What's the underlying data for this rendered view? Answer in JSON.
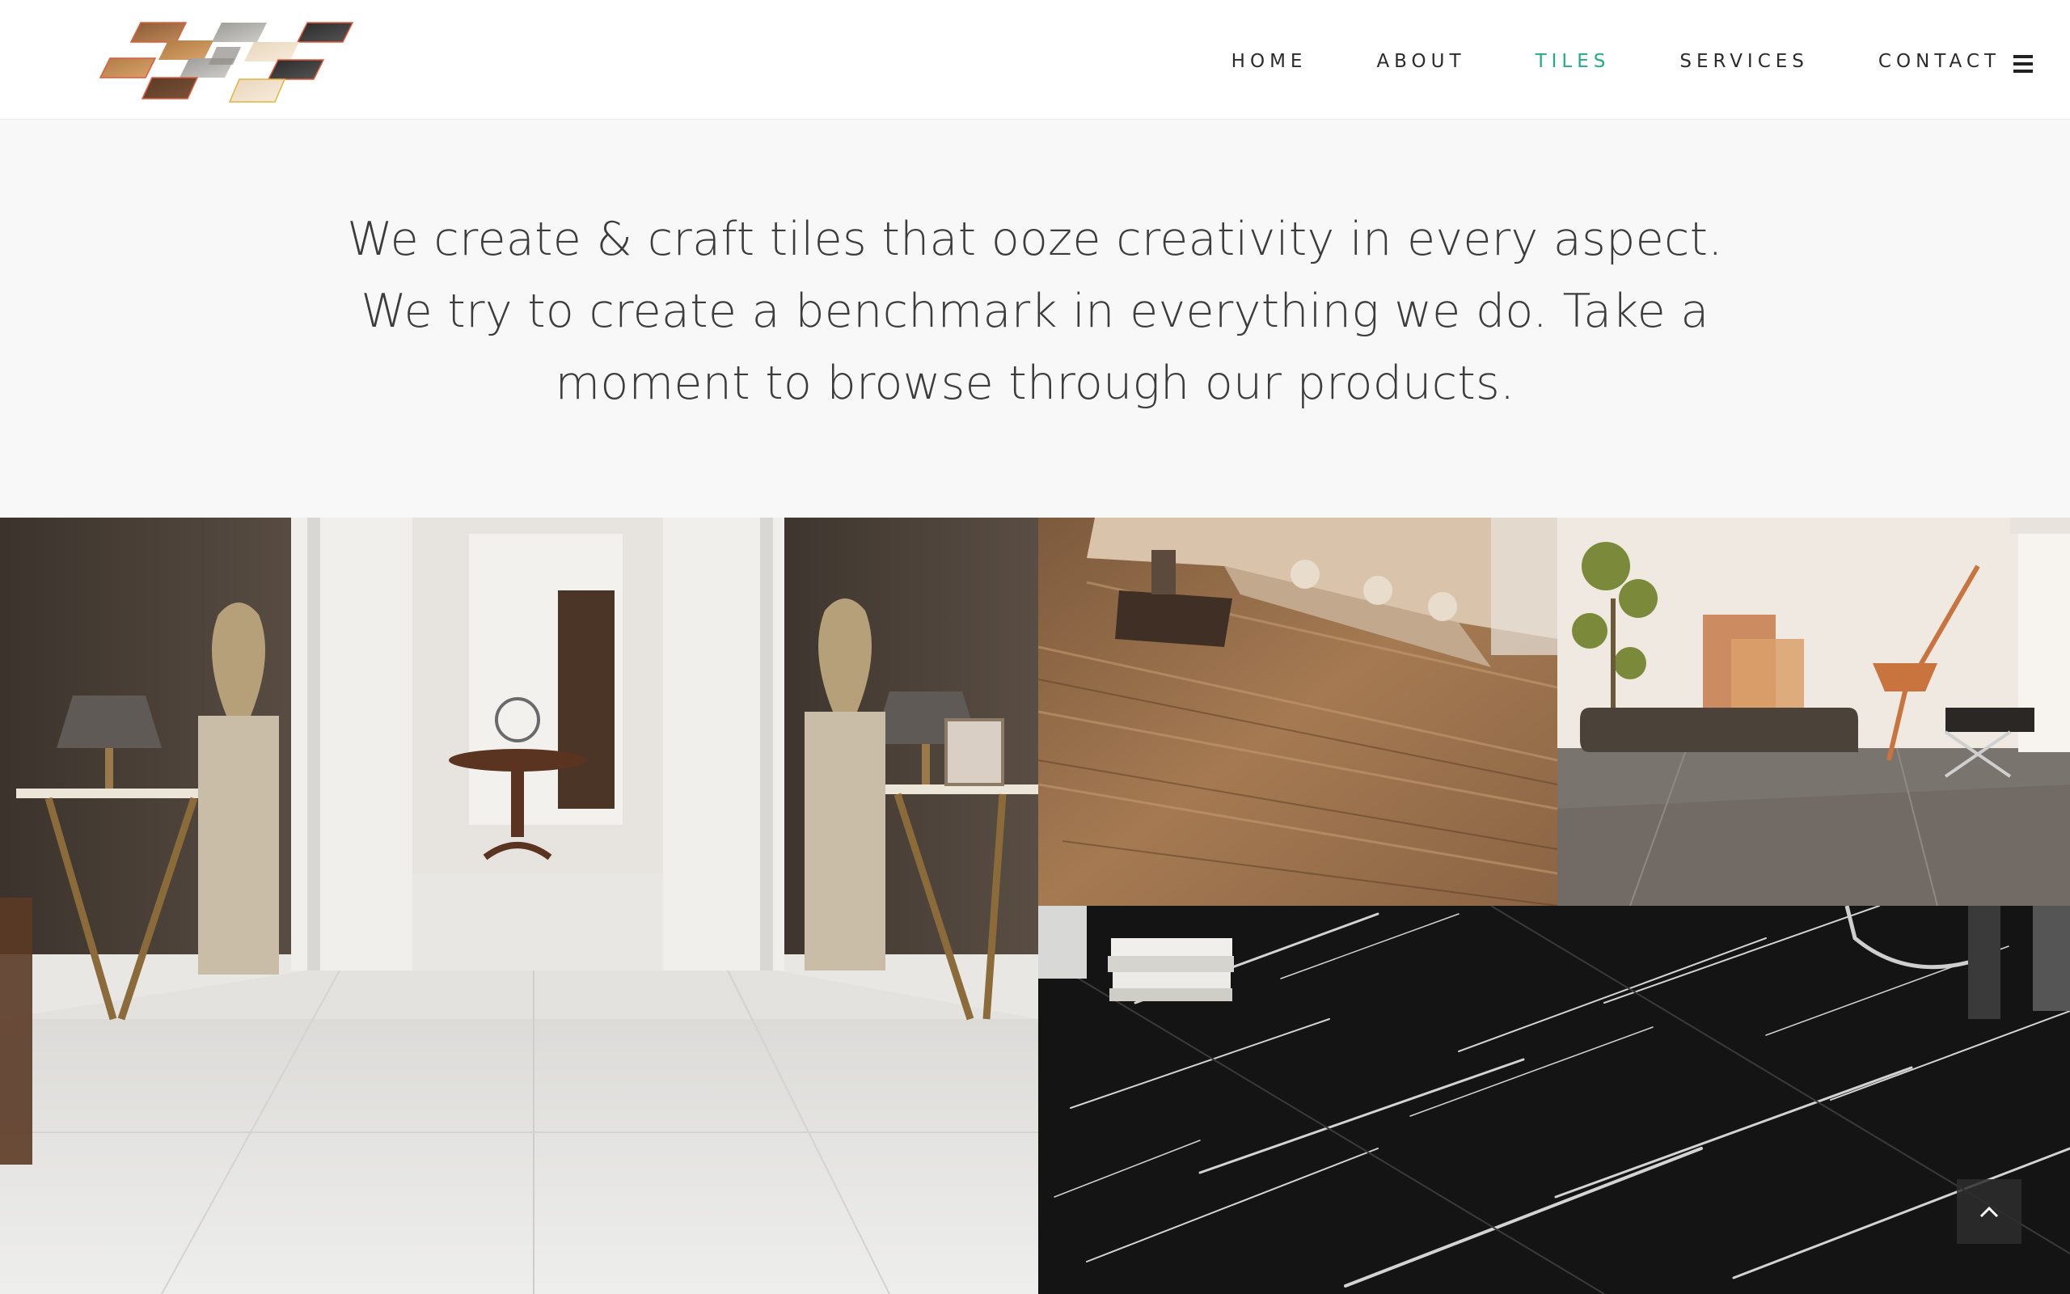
{
  "brand": {
    "logo_icon": "tile-swatches-logo"
  },
  "nav": {
    "items": [
      {
        "label": "HOME",
        "active": false
      },
      {
        "label": "ABOUT",
        "active": false
      },
      {
        "label": "TILES",
        "active": true
      },
      {
        "label": "SERVICES",
        "active": false
      },
      {
        "label": "CONTACT",
        "active": false
      }
    ],
    "menu_icon": "hamburger-menu-icon",
    "active_color": "#1fae86"
  },
  "intro": {
    "text": "We create & craft tiles that ooze creativity in every aspect. We try to create a benchmark in everything we do. Take a moment to browse through our products."
  },
  "gallery": {
    "tiles": [
      {
        "name": "white-onyx-hallway-tile"
      },
      {
        "name": "wood-marble-living-room-tile"
      },
      {
        "name": "grey-stone-lounge-tile"
      },
      {
        "name": "black-marble-floor-tile"
      }
    ]
  },
  "back_to_top": {
    "icon": "chevron-up-icon"
  }
}
